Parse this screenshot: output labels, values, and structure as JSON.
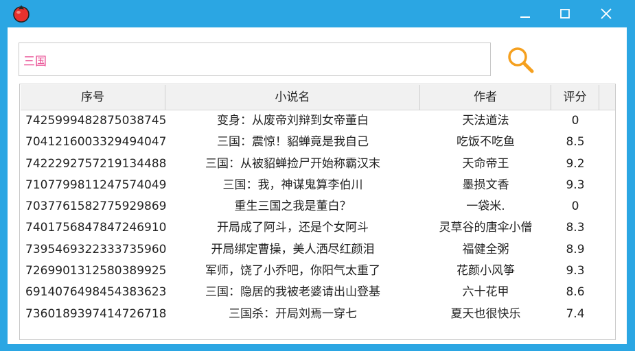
{
  "colors": {
    "frame": "#2ba6e3",
    "search_text": "#e8478f",
    "search_icon": "#f5a01f"
  },
  "titlebar": {
    "app_icon": "tomato-icon",
    "minimize_icon": "minimize-icon",
    "maximize_icon": "maximize-icon",
    "close_icon": "close-icon"
  },
  "search": {
    "value": "三国",
    "icon": "magnifier-icon"
  },
  "table": {
    "columns": [
      "序号",
      "小说名",
      "作者",
      "评分"
    ],
    "rows": [
      {
        "id": "7425999482875038745",
        "title": "变身：从废帝刘辩到女帝董白",
        "author": "天法道法",
        "score": "0"
      },
      {
        "id": "7041216003329494047",
        "title": "三国：震惊！貂蝉竟是我自己",
        "author": "吃饭不吃鱼",
        "score": "8.5"
      },
      {
        "id": "7422292757219134488",
        "title": "三国：从被貂蝉捡尸开始称霸汉末",
        "author": "天命帝王",
        "score": "9.2"
      },
      {
        "id": "7107799811247574049",
        "title": "三国：我，神谋鬼算李伯川",
        "author": "墨损文香",
        "score": "9.3"
      },
      {
        "id": "7037761582775929869",
        "title": "重生三国之我是董白？",
        "author": "一袋米.",
        "score": "0"
      },
      {
        "id": "7401756847847246910",
        "title": "开局成了阿斗，还是个女阿斗",
        "author": "灵草谷的唐伞小僧",
        "score": "8.3"
      },
      {
        "id": "7395469322333735960",
        "title": "开局绑定曹操，美人洒尽红颜泪",
        "author": "福健全粥",
        "score": "8.9"
      },
      {
        "id": "7269901312580389925",
        "title": "军师，饶了小乔吧，你阳气太重了",
        "author": "花颜小风筝",
        "score": "9.3"
      },
      {
        "id": "6914076498454383623",
        "title": "三国：隐居的我被老婆请出山登基",
        "author": "六十花甲",
        "score": "8.6"
      },
      {
        "id": "7360189397414726718",
        "title": "三国杀：开局刘焉一穿七",
        "author": "夏天也很快乐",
        "score": "7.4"
      }
    ]
  }
}
